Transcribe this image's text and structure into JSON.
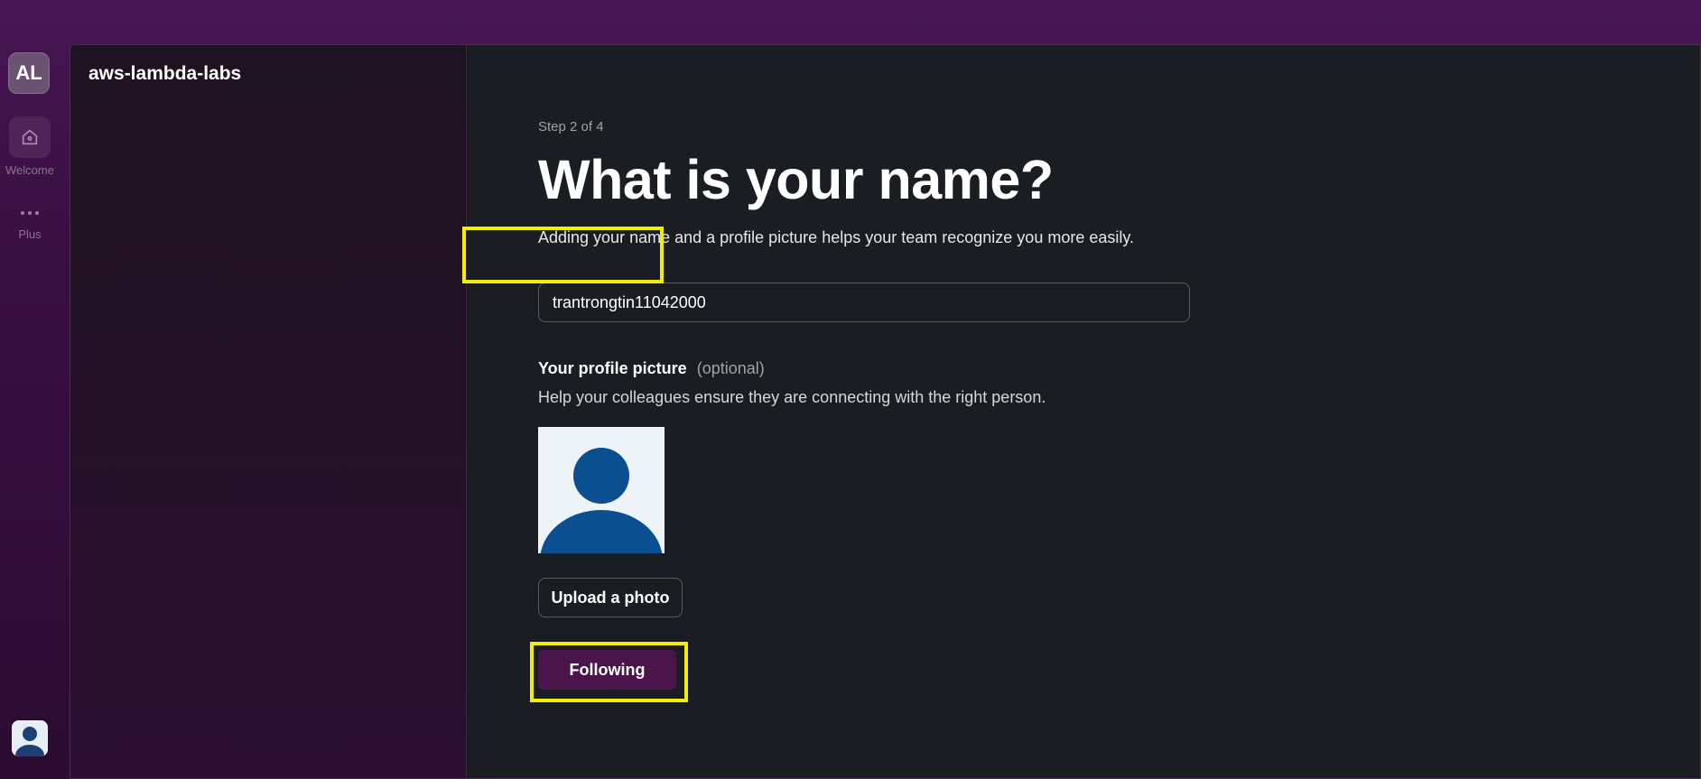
{
  "rail": {
    "workspace_initials": "AL",
    "home_label": "Welcome",
    "more_label": "Plus"
  },
  "sidebar": {
    "workspace_name": "aws-lambda-labs"
  },
  "main": {
    "step": "Step 2 of 4",
    "title": "What is your name?",
    "subtitle": "Adding your name and a profile picture helps your team recognize you more easily.",
    "name_value": "trantrongtin11042000",
    "profile_picture_label": "Your profile picture",
    "profile_picture_optional": "(optional)",
    "profile_picture_help": "Help your colleagues ensure they are connecting with the right person.",
    "upload_button": "Upload a photo",
    "next_button": "Following"
  },
  "colors": {
    "accent": "#4a154b",
    "highlight": "#f4ec0b",
    "avatar_blue": "#0b4f91"
  },
  "icons": {
    "home": "home-icon",
    "more": "more-horizontal-icon",
    "avatar": "user-avatar-icon"
  }
}
